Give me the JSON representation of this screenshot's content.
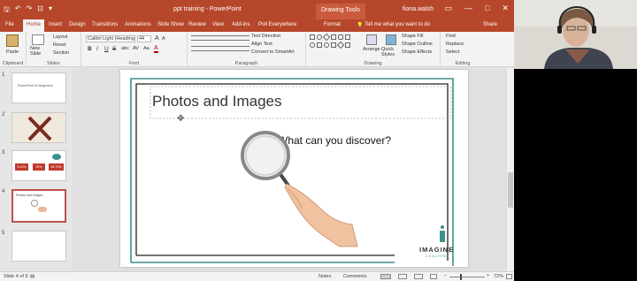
{
  "title_bar": {
    "qat_save": "🖫",
    "qat_undo": "↶",
    "qat_redo": "↷",
    "qat_start": "⊡",
    "qat_more": "▾",
    "document_title": "ppt training - PowerPoint",
    "drawing_tools": "Drawing Tools",
    "user": "fiona.walsh",
    "restore_icon": "▭",
    "minimize": "—",
    "maximize": "□",
    "close": "✕"
  },
  "tabs": [
    "File",
    "Home",
    "Insert",
    "Design",
    "Transitions",
    "Animations",
    "Slide Show",
    "Review",
    "View",
    "Add-ins",
    "Poll Everywhere",
    "Format"
  ],
  "tell_me": "Tell me what you want to do",
  "share": "Share",
  "ribbon": {
    "clipboard": {
      "paste": "Paste",
      "label": "Clipboard"
    },
    "slides": {
      "new_slide": "New Slide",
      "layout": "Layout",
      "reset": "Reset",
      "section": "Section",
      "label": "Slides"
    },
    "font": {
      "name": "Calibri Light (Heading",
      "size": "44",
      "bold": "B",
      "italic": "I",
      "underline": "U",
      "strike": "S",
      "shadow": "abc",
      "spacing": "AV",
      "case": "Aa",
      "grow": "A",
      "shrink": "A",
      "color": "A",
      "label": "Font"
    },
    "paragraph": {
      "text_direction": "Text Direction",
      "align_text": "Align Text",
      "convert_smartart": "Convert to SmartArt",
      "label": "Paragraph"
    },
    "drawing": {
      "arrange": "Arrange",
      "quick_styles": "Quick Styles",
      "shape_fill": "Shape Fill",
      "shape_outline": "Shape Outline",
      "shape_effects": "Shape Effects",
      "label": "Drawing"
    },
    "editing": {
      "find": "Find",
      "replace": "Replace",
      "select": "Select",
      "label": "Editing"
    }
  },
  "thumbnails": [
    {
      "num": "1",
      "text": "PowerPoint for Beginners"
    },
    {
      "num": "2",
      "text": ""
    },
    {
      "num": "3",
      "stats": [
        "5-10%",
        "25%",
        "65-70%"
      ]
    },
    {
      "num": "4",
      "text": "Photos and Images"
    },
    {
      "num": "5",
      "text": ""
    }
  ],
  "slide": {
    "title": "Photos and Images",
    "question": "What can you discover?",
    "logo_name": "IMAGINE",
    "logo_tagline": "COACHING"
  },
  "status": {
    "slide_info": "Slide 4 of 5",
    "notes": "Notes",
    "comments": "Comments",
    "zoom": "72%",
    "zoom_out": "–",
    "zoom_in": "+"
  },
  "colors": {
    "accent": "#b7472a",
    "teal": "#3d8f8a"
  }
}
